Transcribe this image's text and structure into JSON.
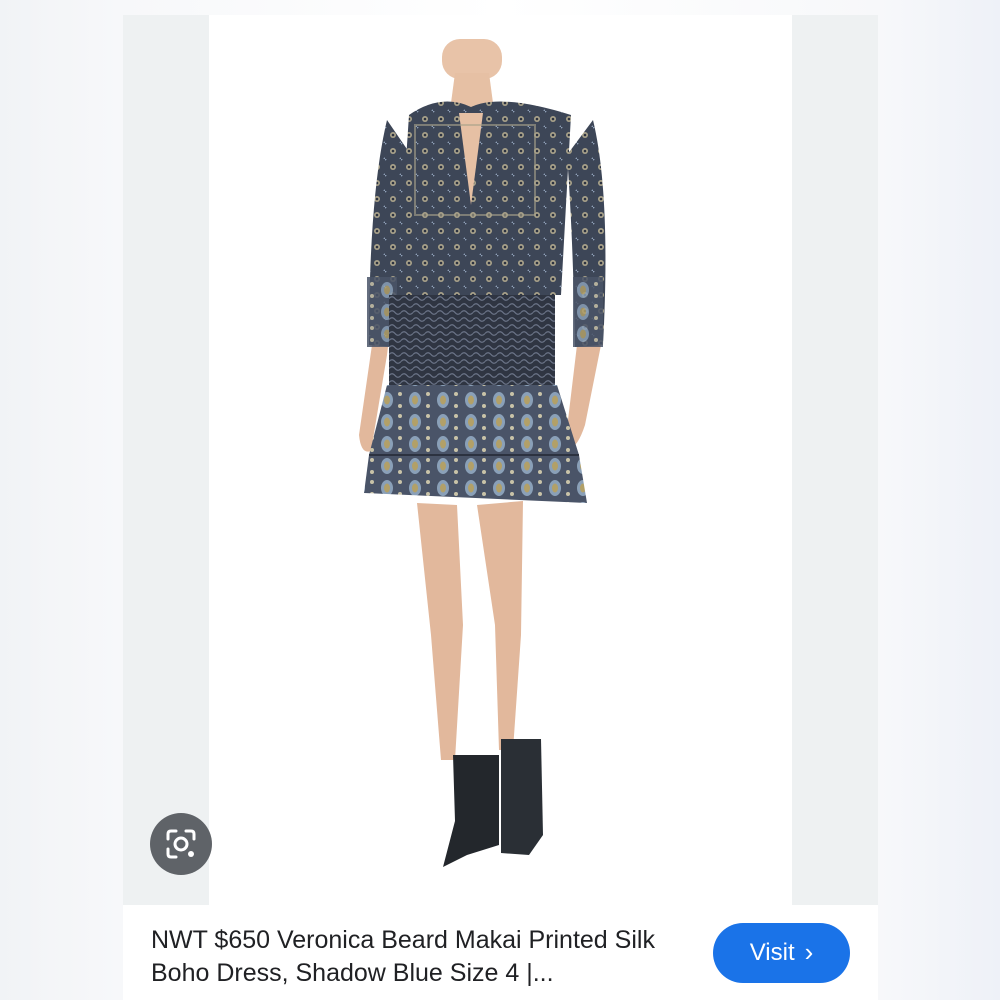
{
  "result": {
    "title": "NWT $650 Veronica Beard Makai Printed Silk Boho Dress, Shadow Blue Size 4 |...",
    "visit_label": "Visit",
    "visit_icon": "chevron-right-icon",
    "lens_icon": "google-lens-icon",
    "image_subject": "product-photo-dress"
  },
  "colors": {
    "accent": "#1a73e8",
    "lens_button": "#5f6368",
    "side_panel": "#eef1f2",
    "title_text": "#202124"
  }
}
